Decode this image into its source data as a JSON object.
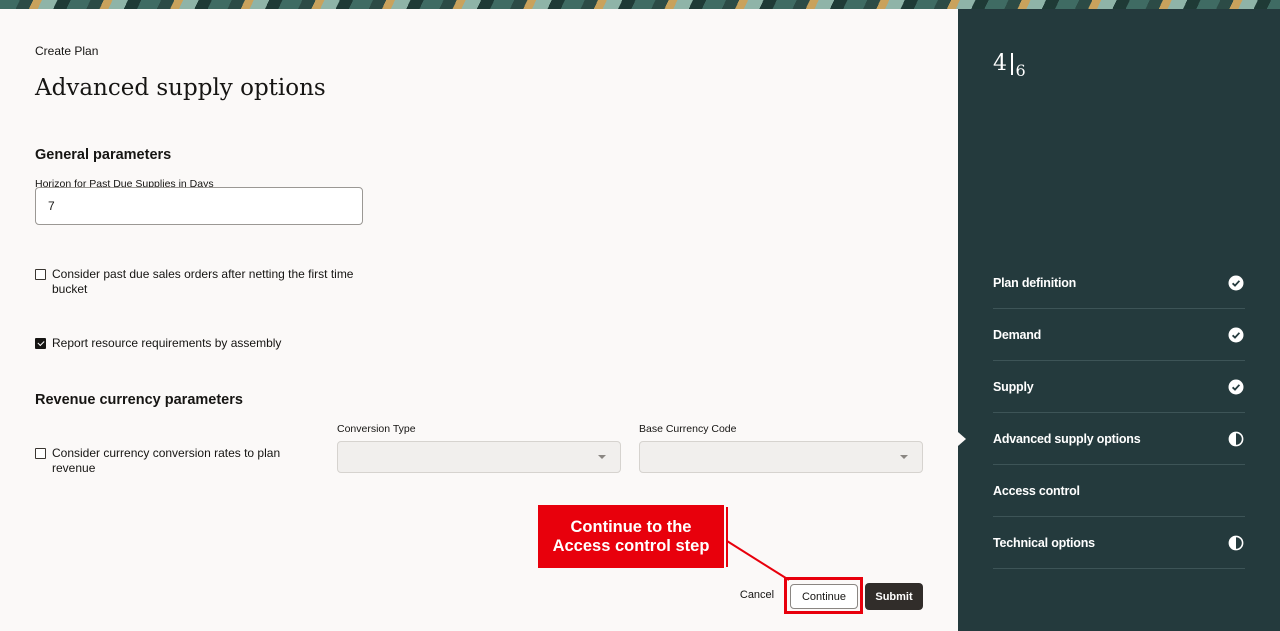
{
  "breadcrumb": "Create Plan",
  "page_title": "Advanced supply options",
  "general": {
    "section_title": "General parameters",
    "horizon_label": "Horizon for Past Due Supplies in Days",
    "horizon_value": "7",
    "past_due_checkbox": {
      "label": "Consider past due sales orders after netting the first time bucket",
      "checked": false
    },
    "resource_checkbox": {
      "label": "Report resource requirements by assembly",
      "checked": true
    }
  },
  "revenue": {
    "section_title": "Revenue currency parameters",
    "currency_checkbox": {
      "label": "Consider currency conversion rates to plan revenue",
      "checked": false
    },
    "conversion_type_label": "Conversion Type",
    "conversion_type_value": "",
    "base_currency_label": "Base Currency Code",
    "base_currency_value": ""
  },
  "actions": {
    "cancel_label": "Cancel",
    "continue_label": "Continue",
    "submit_label": "Submit"
  },
  "annotation": {
    "text": "Continue to the Access control step",
    "color": "#e8000c"
  },
  "sidebar": {
    "current_step": "4",
    "total_steps": "6",
    "steps": [
      {
        "label": "Plan definition",
        "status": "complete",
        "icon": "check-circle-icon"
      },
      {
        "label": "Demand",
        "status": "complete",
        "icon": "check-circle-icon"
      },
      {
        "label": "Supply",
        "status": "complete",
        "icon": "check-circle-icon"
      },
      {
        "label": "Advanced supply options",
        "status": "in-progress",
        "icon": "half-circle-icon",
        "current": true
      },
      {
        "label": "Access control",
        "status": "not-started",
        "icon": ""
      },
      {
        "label": "Technical options",
        "status": "in-progress",
        "icon": "half-circle-icon"
      }
    ]
  },
  "colors": {
    "sidebar_bg": "#243a3d",
    "main_bg": "#fbf9f8",
    "submit_bg": "#312d2a"
  }
}
